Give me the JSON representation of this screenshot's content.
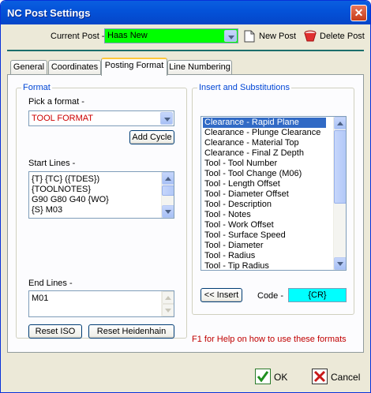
{
  "window": {
    "title": "NC Post Settings",
    "close_glyph": "✕"
  },
  "toolbar": {
    "current_post_label": "Current Post -",
    "current_post_value": "Haas New",
    "new_post_label": "New Post",
    "delete_post_label": "Delete Post"
  },
  "tabs": [
    {
      "label": "General"
    },
    {
      "label": "Coordinates"
    },
    {
      "label": "Posting Format"
    },
    {
      "label": "Line Numbering"
    }
  ],
  "format": {
    "group_title": "Format",
    "pick_label": "Pick a format -",
    "pick_value": "TOOL FORMAT",
    "add_cycle_label": "Add Cycle",
    "start_lines_label": "Start Lines -",
    "start_lines": [
      "{T} {TC} ({TDES})",
      "{TOOLNOTES}",
      "G90 G80 G40 {WO}",
      "{S} M03"
    ],
    "end_lines_label": "End Lines -",
    "end_lines": [
      "M01"
    ],
    "reset_iso_label": "Reset ISO",
    "reset_heidenhain_label": "Reset Heidenhain"
  },
  "insert": {
    "group_title": "Insert and Substitutions",
    "items": [
      "Clearance - Rapid Plane",
      "Clearance - Plunge Clearance",
      "Clearance - Material Top",
      "Clearance - Final Z Depth",
      "Tool - Tool Number",
      "Tool - Tool Change (M06)",
      "Tool - Length Offset",
      "Tool - Diameter Offset",
      "Tool - Description",
      "Tool - Notes",
      "Tool - Work Offset",
      "Tool - Surface Speed",
      "Tool - Diameter",
      "Tool - Radius",
      "Tool - Tip Radius"
    ],
    "selected_index": 0,
    "insert_button_label": "<< Insert",
    "code_label": "Code -",
    "code_value": "{CR}"
  },
  "help_text": "F1 for Help on how to use these formats",
  "footer": {
    "ok_label": "OK",
    "cancel_label": "Cancel"
  },
  "colors": {
    "post_combo_bg": "#00ff00",
    "code_bg": "#00ffff",
    "pick_value_color": "#cc0000",
    "help_color": "#c00000",
    "accent": "#0046d5"
  }
}
